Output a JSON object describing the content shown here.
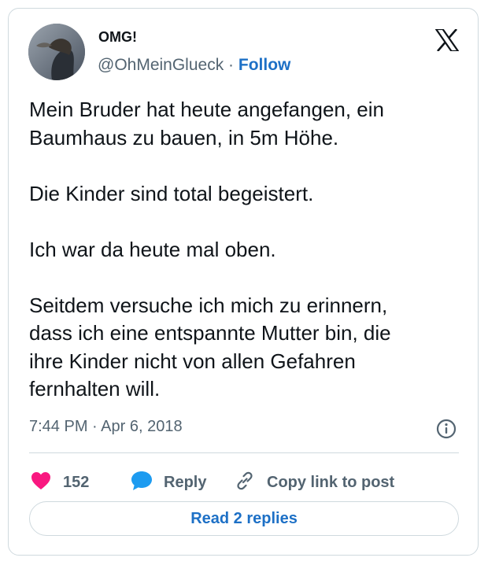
{
  "author": {
    "display_name": "OMG!",
    "handle": "@OhMeinGlueck",
    "separator": " · ",
    "follow_label": "Follow"
  },
  "tweet": {
    "paragraphs": [
      [
        "Mein Bruder hat heute angefangen, ein",
        "Baumhaus zu bauen, in 5m Höhe."
      ],
      [
        "Die Kinder sind total begeistert."
      ],
      [
        "Ich war da heute mal oben."
      ],
      [
        "Seitdem versuche ich mich zu erinnern,",
        "dass ich eine entspannte Mutter bin, die",
        "ihre Kinder nicht von allen Gefahren",
        "fernhalten will."
      ]
    ],
    "timestamp": "7:44 PM · Apr 6, 2018"
  },
  "actions": {
    "like_count": "152",
    "reply_label": "Reply",
    "copy_link_label": "Copy link to post"
  },
  "read_replies_label": "Read 2 replies",
  "colors": {
    "like": "#f91880",
    "reply": "#1d9bf0",
    "link": "#1d70c6",
    "muted": "#536471"
  },
  "icons": {
    "brand": "x-logo-icon",
    "info": "info-icon",
    "like": "heart-icon",
    "reply": "speech-bubble-icon",
    "copy": "link-icon"
  }
}
